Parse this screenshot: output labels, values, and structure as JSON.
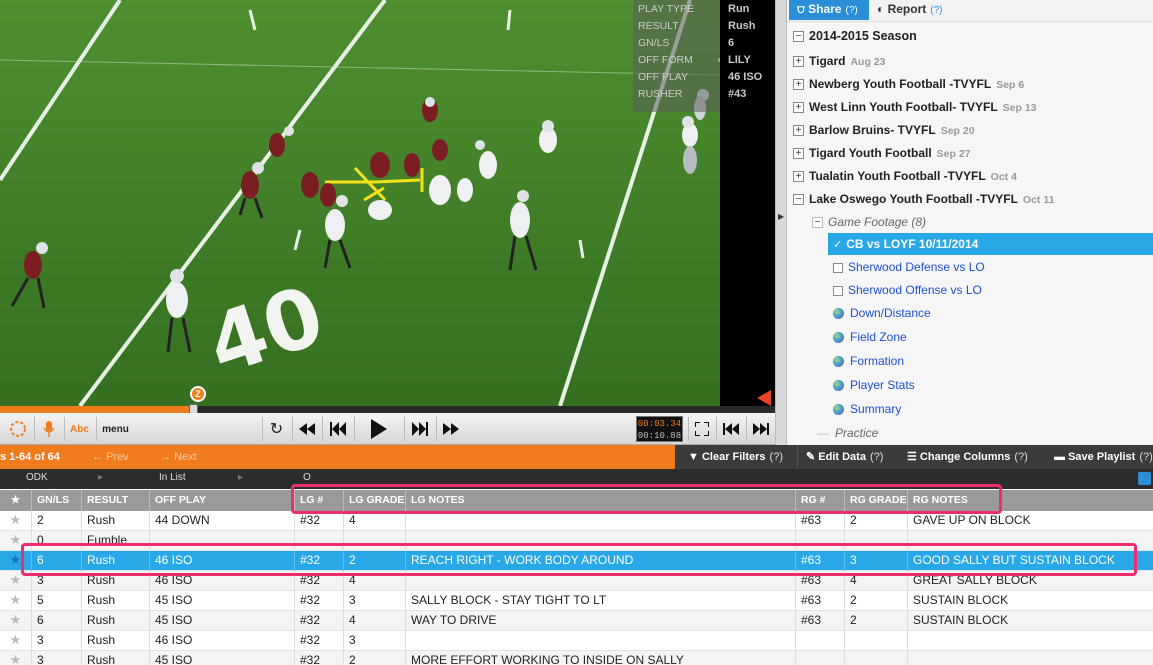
{
  "video": {
    "overlay_labels": [
      "PLAY TYPE",
      "RESULT",
      "GN/LS",
      "OFF FORM",
      "OFF PLAY",
      "RUSHER"
    ],
    "overlay_values": [
      "Run",
      "Rush",
      "6",
      "LILY",
      "46 ISO",
      "#43"
    ],
    "field_number": "40",
    "time_current": "00:03.34",
    "time_total": "00:10.88",
    "colors": {
      "field": "#3f7d27",
      "accent": "#f07c1e"
    }
  },
  "controls": {
    "menu_label": "menu",
    "abc_label": "Abc",
    "marker_label": "Z"
  },
  "panel": {
    "share_label": "Share",
    "report_label": "Report",
    "help": "(?)",
    "season": "2014-2015 Season",
    "games": [
      {
        "name": "Tigard",
        "date": "Aug 23"
      },
      {
        "name": "Newberg Youth Football -TVYFL",
        "date": "Sep 6"
      },
      {
        "name": "West Linn Youth Football- TVYFL",
        "date": "Sep 13"
      },
      {
        "name": "Barlow Bruins- TVYFL",
        "date": "Sep 20"
      },
      {
        "name": "Tigard Youth Football",
        "date": "Sep 27"
      },
      {
        "name": "Tualatin Youth Football -TVYFL",
        "date": "Oct 4"
      },
      {
        "name": "Lake Oswego Youth Football -TVYFL",
        "date": "Oct 11"
      }
    ],
    "footage_label": "Game Footage (8)",
    "selected_clip": "CB vs LOYF 10/11/2014",
    "clips": [
      "Sherwood Defense vs LO",
      "Sherwood Offense vs LO"
    ],
    "reports": [
      "Down/Distance",
      "Field Zone",
      "Formation",
      "Player Stats",
      "Summary"
    ],
    "practice_label": "Practice"
  },
  "nav": {
    "plays_count": "s 1-64 of 64",
    "prev": "Prev",
    "next": "Next",
    "clear_filters": "Clear Filters",
    "edit_data": "Edit Data",
    "change_columns": "Change Columns",
    "save_playlist": "Save Playlist",
    "help": "(?)"
  },
  "filters": {
    "odk": "ODK",
    "in_list": "In List",
    "o": "O"
  },
  "table": {
    "columns": [
      "GN/LS",
      "RESULT",
      "OFF PLAY",
      "LG #",
      "LG GRADE",
      "LG NOTES",
      "RG #",
      "RG GRADE",
      "RG NOTES"
    ],
    "rows": [
      [
        "2",
        "Rush",
        "44 DOWN",
        "#32",
        "4",
        "",
        "#63",
        "2",
        "GAVE UP ON BLOCK"
      ],
      [
        "0",
        "Fumble",
        "",
        "",
        "",
        "",
        "",
        "",
        ""
      ],
      [
        "6",
        "Rush",
        "46 ISO",
        "#32",
        "2",
        "REACH RIGHT - WORK BODY AROUND",
        "#63",
        "3",
        "GOOD SALLY BUT SUSTAIN BLOCK"
      ],
      [
        "3",
        "Rush",
        "46 ISO",
        "#32",
        "4",
        "",
        "#63",
        "4",
        "GREAT SALLY BLOCK"
      ],
      [
        "5",
        "Rush",
        "45 ISO",
        "#32",
        "3",
        "SALLY BLOCK - STAY TIGHT TO LT",
        "#63",
        "2",
        "SUSTAIN BLOCK"
      ],
      [
        "6",
        "Rush",
        "45 ISO",
        "#32",
        "4",
        "WAY TO DRIVE",
        "#63",
        "2",
        "SUSTAIN BLOCK"
      ],
      [
        "3",
        "Rush",
        "46 ISO",
        "#32",
        "3",
        "",
        "",
        "",
        ""
      ],
      [
        "3",
        "Rush",
        "45 ISO",
        "#32",
        "2",
        "MORE EFFORT WORKING TO INSIDE ON SALLY",
        "",
        "",
        ""
      ]
    ],
    "highlight_color": "#29a8e8",
    "annotation_color": "#ef2d6c"
  }
}
